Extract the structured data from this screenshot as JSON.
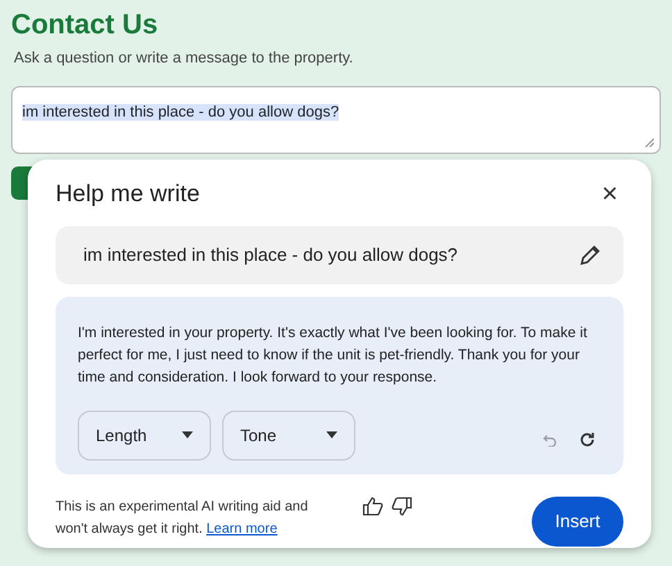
{
  "page": {
    "title": "Contact Us",
    "subtitle": "Ask a question or write a message to the property."
  },
  "message_field": {
    "value": "im interested in this place - do you allow dogs?",
    "highlighted": true
  },
  "dialog": {
    "title": "Help me write",
    "close": "×",
    "prompt": "im interested in this place - do you allow dogs?",
    "result": "I'm interested in your property. It's exactly what I've been looking for. To make it perfect for me, I just need to know if the unit is pet-friendly. Thank you for your time and consideration. I look forward to your response.",
    "dropdowns": [
      {
        "label": "Length"
      },
      {
        "label": "Tone"
      }
    ],
    "undo": {
      "disabled": true
    },
    "disclaimer": "This is an experimental AI writing aid and won't always get it right.",
    "link": "Learn more",
    "insert_button": "Insert"
  }
}
